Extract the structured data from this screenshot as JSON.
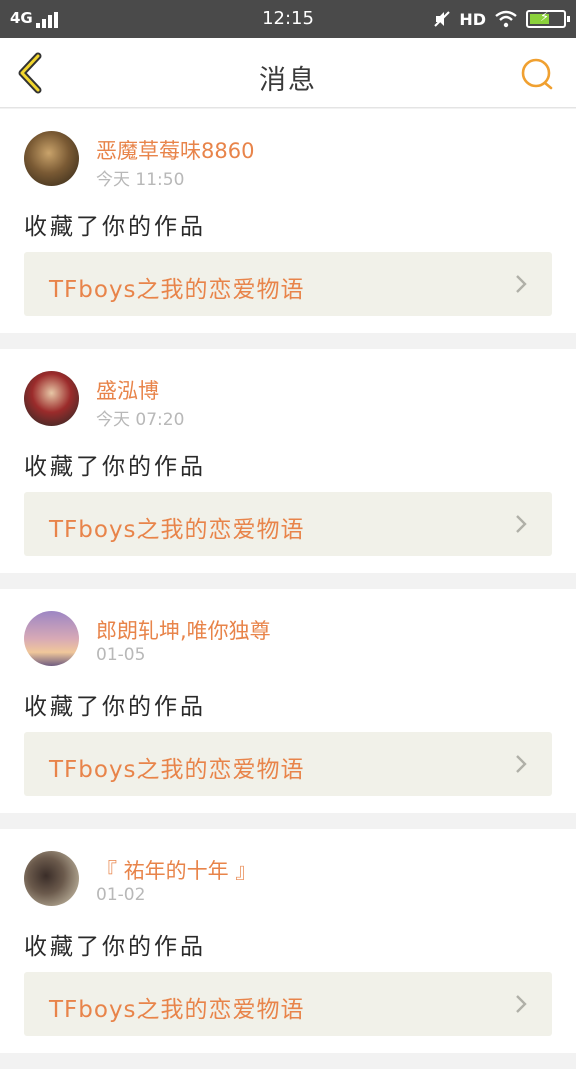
{
  "status_bar": {
    "network": "4G",
    "time": "12:15",
    "hd_label": "HD",
    "icons": [
      "signal-bars-icon",
      "mute-icon",
      "wifi-icon",
      "battery-charging-icon"
    ],
    "battery_level": 0.6,
    "battery_color": "#8bd13b"
  },
  "header": {
    "title": "消息",
    "back_icon": "chevron-left-icon",
    "search_icon": "search-icon",
    "accent_color": "#f0a030"
  },
  "messages": [
    {
      "username": "恶魔草莓味8860",
      "time": "今天 11:50",
      "action": "收藏了你的作品",
      "work_title": "TFboys之我的恋爱物语"
    },
    {
      "username": "盛泓博",
      "time": "今天 07:20",
      "action": "收藏了你的作品",
      "work_title": "TFboys之我的恋爱物语"
    },
    {
      "username": "郎朗轧坤,唯你独尊",
      "time": "01-05",
      "action": "收藏了你的作品",
      "work_title": "TFboys之我的恋爱物语"
    },
    {
      "username": "『 祐年的十年 』",
      "time": "01-02",
      "action": "收藏了你的作品",
      "work_title": "TFboys之我的恋爱物语"
    }
  ],
  "colors": {
    "link_orange": "#e8844a",
    "card_bg": "#ffffff",
    "work_bg": "#f1f1e9",
    "status_bg": "#4a4a4a"
  }
}
